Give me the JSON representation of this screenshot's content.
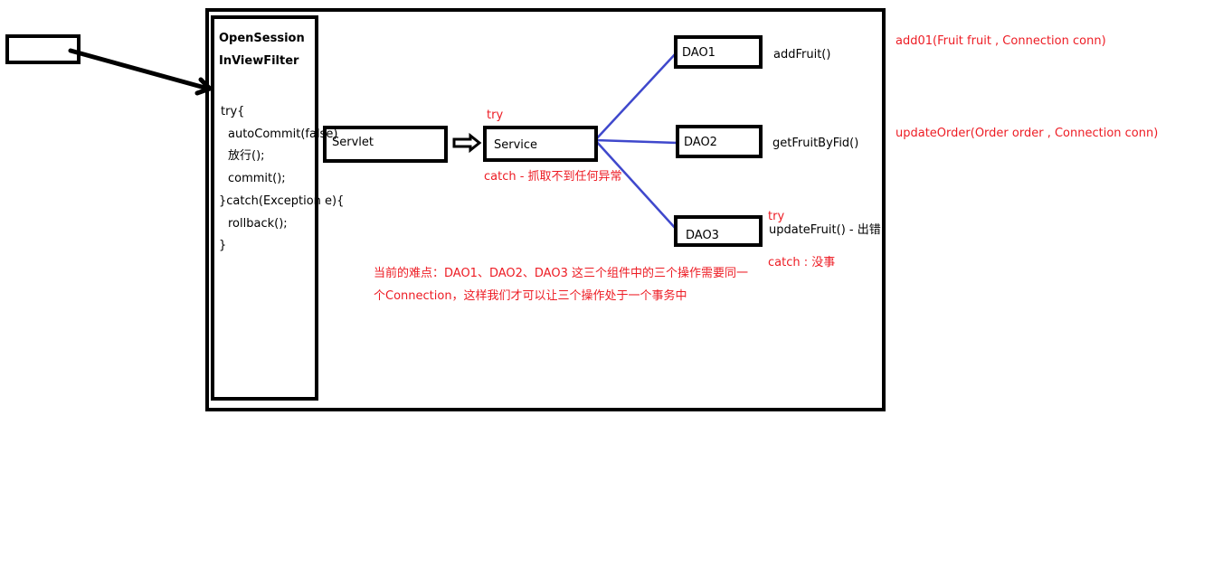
{
  "colors": {
    "red_text": "#ed1c24",
    "blue_line": "#3f48cc",
    "black": "#000000"
  },
  "filter": {
    "title_line1": "OpenSession",
    "title_line2": "InViewFilter",
    "code": [
      "try{",
      "  autoCommit(false)",
      "  放行();",
      "  commit();",
      "}catch(Exception e){",
      "  rollback();",
      "}"
    ]
  },
  "servlet": {
    "label": "Servlet"
  },
  "service": {
    "label": "Service",
    "try_label": "try",
    "catch_label": "catch  - 抓取不到任何异常"
  },
  "daos": [
    {
      "label": "DAO1",
      "method": "addFruit()"
    },
    {
      "label": "DAO2",
      "method": "getFruitByFid()"
    },
    {
      "label": "DAO3",
      "method": "updateFruit() - 出错",
      "try_label": "try",
      "catch_label": "catch : 没事"
    }
  ],
  "note": {
    "line1": "当前的难点：DAO1、DAO2、DAO3 这三个组件中的三个操作需要同一",
    "line2": "个Connection，这样我们才可以让三个操作处于一个事务中"
  },
  "signatures": {
    "add": "add01(Fruit fruit , Connection conn)",
    "update": "updateOrder(Order order , Connection conn)"
  }
}
